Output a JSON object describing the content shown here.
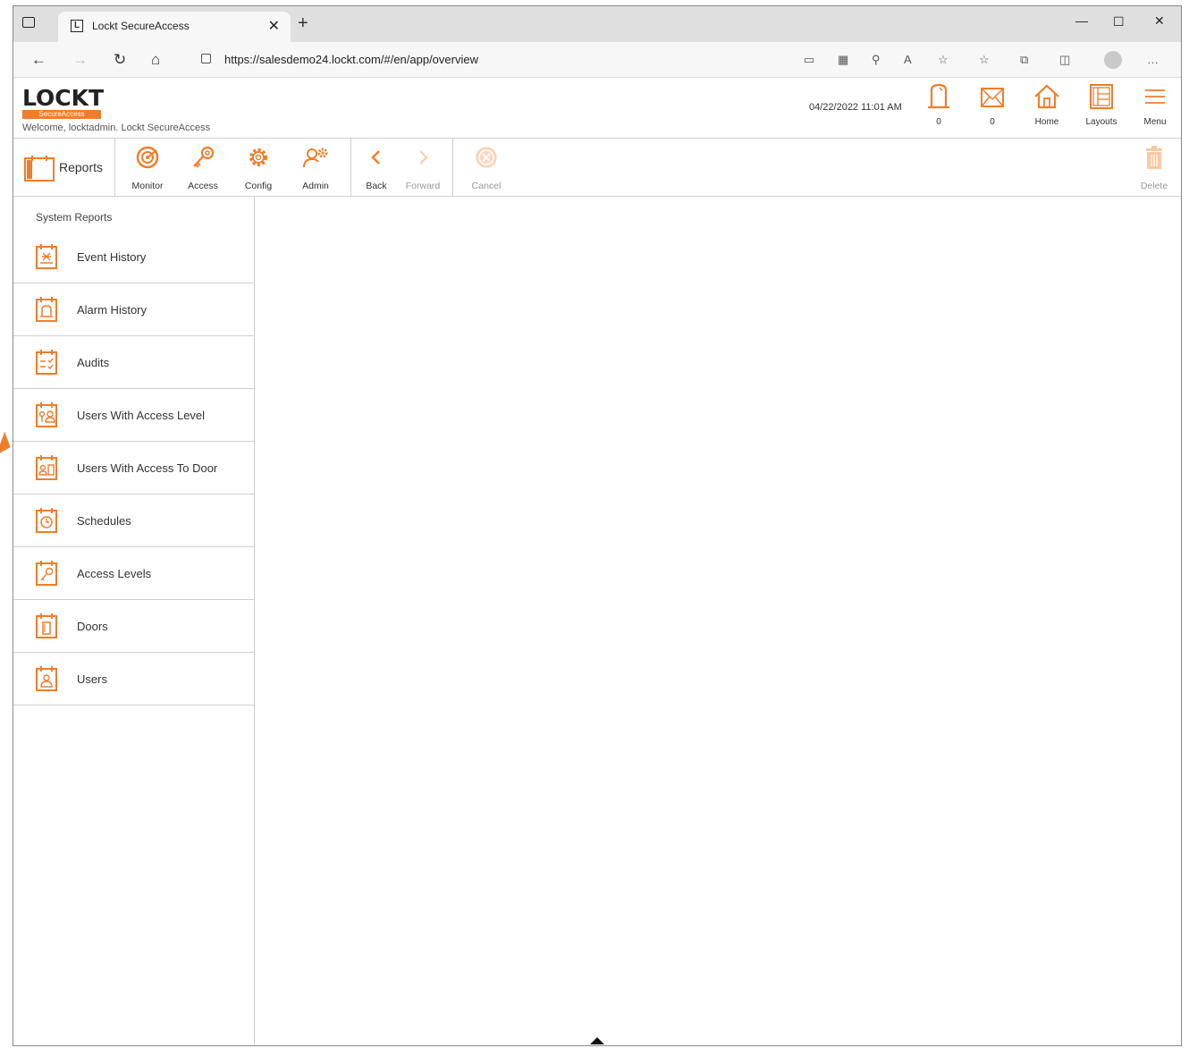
{
  "browser": {
    "tab_title": "Lockt SecureAccess",
    "favicon_letter": "L",
    "url": "https://salesdemo24.lockt.com/#/en/app/overview"
  },
  "header": {
    "logo": "LOCKT",
    "logo_sub": "SecureAccess",
    "welcome": "Welcome, locktadmin.  Lockt SecureAccess",
    "datetime": "04/22/2022 11:01 AM",
    "alarms_count": "0",
    "messages_count": "0",
    "home_label": "Home",
    "layouts_label": "Layouts",
    "menu_label": "Menu"
  },
  "toolbar": {
    "reports_label": "Reports",
    "monitor_label": "Monitor",
    "access_label": "Access",
    "config_label": "Config",
    "admin_label": "Admin",
    "back_label": "Back",
    "forward_label": "Forward",
    "cancel_label": "Cancel",
    "delete_label": "Delete"
  },
  "sidebar": {
    "title": "System Reports",
    "items": [
      {
        "label": "Event History",
        "icon": "event-history-icon"
      },
      {
        "label": "Alarm History",
        "icon": "alarm-history-icon"
      },
      {
        "label": "Audits",
        "icon": "audits-icon"
      },
      {
        "label": "Users With Access Level",
        "icon": "users-access-level-icon"
      },
      {
        "label": "Users With Access To Door",
        "icon": "users-access-door-icon"
      },
      {
        "label": "Schedules",
        "icon": "schedules-icon"
      },
      {
        "label": "Access Levels",
        "icon": "access-levels-icon"
      },
      {
        "label": "Doors",
        "icon": "doors-icon"
      },
      {
        "label": "Users",
        "icon": "users-icon"
      }
    ]
  },
  "colors": {
    "accent": "#f07d2b",
    "border": "#d0d0d0"
  }
}
